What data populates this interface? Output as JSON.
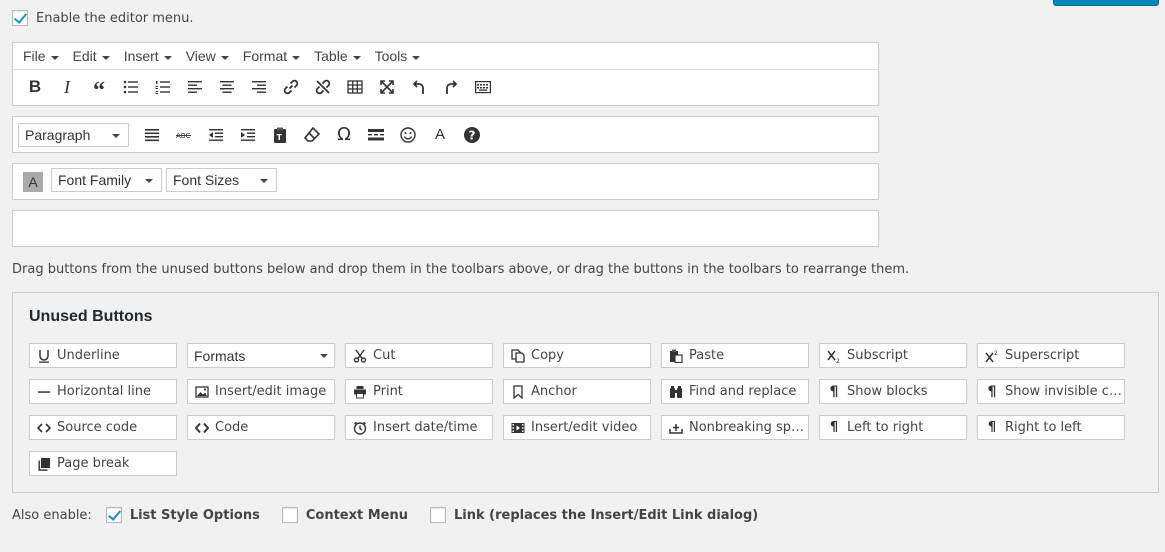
{
  "enable_editor_menu": {
    "label": "Enable the editor menu.",
    "checked": true
  },
  "menubar": [
    {
      "label": "File"
    },
    {
      "label": "Edit"
    },
    {
      "label": "Insert"
    },
    {
      "label": "View"
    },
    {
      "label": "Format"
    },
    {
      "label": "Table"
    },
    {
      "label": "Tools"
    }
  ],
  "toolbar1": [
    "bold-icon",
    "italic-icon",
    "blockquote-icon",
    "bullet-list-icon",
    "numbered-list-icon",
    "align-left-icon",
    "align-center-icon",
    "align-right-icon",
    "link-icon",
    "unlink-icon",
    "table-icon",
    "fullscreen-icon",
    "undo-icon",
    "redo-icon",
    "keyboard-toggle-icon"
  ],
  "toolbar2": {
    "paragraph_select": "Paragraph",
    "buttons": [
      "justify-icon",
      "strikethrough-icon",
      "outdent-icon",
      "indent-icon",
      "paste-text-icon",
      "clear-formatting-icon",
      "special-character-icon",
      "wp-page-icon",
      "emoticons-icon",
      "text-color-icon",
      "help-icon"
    ]
  },
  "toolbar3": {
    "backcolor_glyph": "A",
    "font_family": "Font Family",
    "font_sizes": "Font Sizes"
  },
  "instructions": "Drag buttons from the unused buttons below and drop them in the toolbars above, or drag the buttons in the toolbars to rearrange them.",
  "unused": {
    "title": "Unused Buttons",
    "buttons": {
      "underline": "Underline",
      "formats": "Formats",
      "cut": "Cut",
      "copy": "Copy",
      "paste": "Paste",
      "subscript": "Subscript",
      "superscript": "Superscript",
      "hr": "Horizontal line",
      "image": "Insert/edit image",
      "print": "Print",
      "anchor": "Anchor",
      "find": "Find and replace",
      "showblocks": "Show blocks",
      "invisibles": "Show invisible cha...",
      "sourcecode": "Source code",
      "code": "Code",
      "datetime": "Insert date/time",
      "video": "Insert/edit video",
      "nbsp": "Nonbreaking space",
      "ltr": "Left to right",
      "rtl": "Right to left",
      "pagebreak": "Page break"
    }
  },
  "also_enable": {
    "label": "Also enable:",
    "options": [
      {
        "label": "List Style Options",
        "checked": true
      },
      {
        "label": "Context Menu",
        "checked": false
      },
      {
        "label": "Link (replaces the Insert/Edit Link dialog)",
        "checked": false
      }
    ]
  },
  "colors": {
    "accent": "#1e8cbe",
    "primary_button": "#0085ba"
  }
}
